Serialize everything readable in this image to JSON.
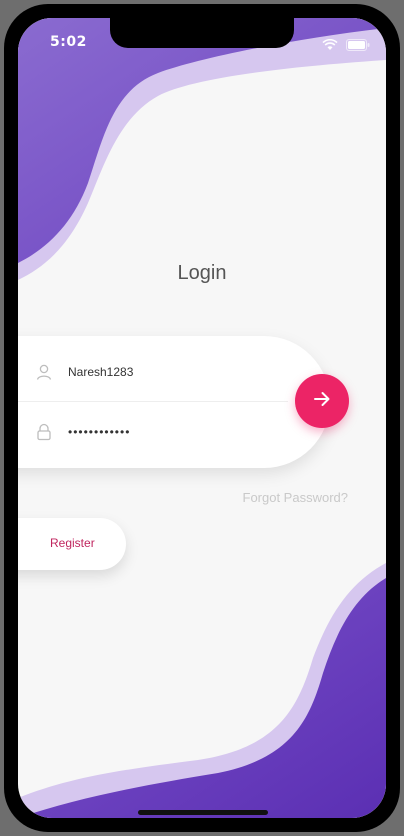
{
  "status_bar": {
    "time": "5:02"
  },
  "login": {
    "title": "Login",
    "username_value": "Naresh1283",
    "password_value": "••••••••••••",
    "forgot_password_label": "Forgot Password?",
    "register_label": "Register"
  },
  "colors": {
    "accent_pink": "#ec2466",
    "purple_dark": "#6a3fbf",
    "purple_light": "#d6c7ef",
    "register_text": "#c0265f"
  },
  "icons": {
    "username": "person-icon",
    "password": "lock-icon",
    "submit": "arrow-right-icon",
    "wifi": "wifi-icon",
    "battery": "battery-icon"
  }
}
